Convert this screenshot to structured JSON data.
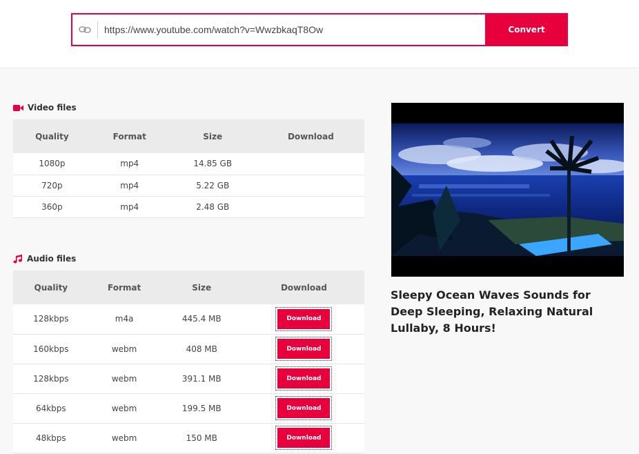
{
  "search": {
    "url_value": "https://www.youtube.com/watch?v=WwzbkaqT8Ow",
    "convert_label": "Convert"
  },
  "video_section": {
    "title": "Video files",
    "headers": [
      "Quality",
      "Format",
      "Size",
      "Download"
    ],
    "rows": [
      {
        "quality": "1080p",
        "format": "mp4",
        "size": "14.85 GB"
      },
      {
        "quality": "720p",
        "format": "mp4",
        "size": "5.22 GB"
      },
      {
        "quality": "360p",
        "format": "mp4",
        "size": "2.48 GB"
      }
    ]
  },
  "audio_section": {
    "title": "Audio files",
    "headers": [
      "Quality",
      "Format",
      "Size",
      "Download"
    ],
    "download_label": "Download",
    "rows": [
      {
        "quality": "128kbps",
        "format": "m4a",
        "size": "445.4 MB"
      },
      {
        "quality": "160kbps",
        "format": "webm",
        "size": "408 MB"
      },
      {
        "quality": "128kbps",
        "format": "webm",
        "size": "391.1 MB"
      },
      {
        "quality": "64kbps",
        "format": "webm",
        "size": "199.5 MB"
      },
      {
        "quality": "48kbps",
        "format": "webm",
        "size": "150 MB"
      }
    ]
  },
  "video_info": {
    "title": "Sleepy Ocean Waves Sounds for Deep Sleeping, Relaxing Natural Lullaby, 8 Hours!"
  },
  "colors": {
    "accent": "#e8003d",
    "header_bg": "#ebebeb",
    "page_bg": "#f8f8f8"
  },
  "icons": {
    "url": "link-icon",
    "video": "video-camera-icon",
    "audio": "music-note-icon"
  }
}
